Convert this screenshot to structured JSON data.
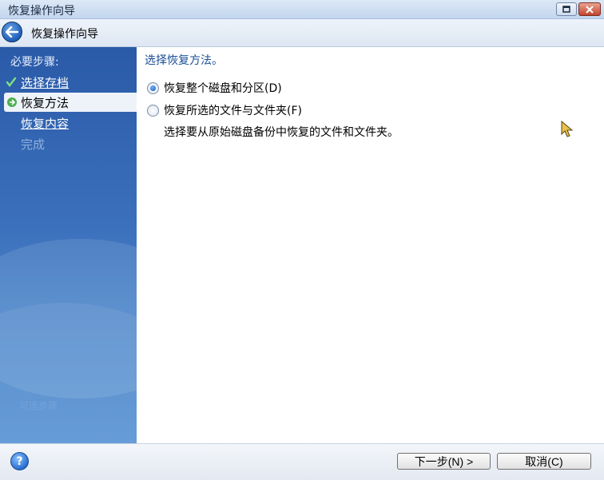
{
  "window": {
    "title": "恢复操作向导",
    "controls": [
      "restore-icon",
      "close-icon"
    ]
  },
  "header": {
    "title": "恢复操作向导",
    "back_icon": "back-arrow-icon"
  },
  "sidebar": {
    "heading": "必要步骤:",
    "steps": [
      {
        "label": "选择存档",
        "state": "done",
        "icon": "checkmark-icon"
      },
      {
        "label": "恢复方法",
        "state": "current",
        "icon": "arrow-right-icon"
      },
      {
        "label": "恢复内容",
        "state": "link"
      },
      {
        "label": "完成",
        "state": "disabled"
      }
    ],
    "footer_faded": "可选步骤"
  },
  "main": {
    "section_title": "选择恢复方法。",
    "options": [
      {
        "label": "恢复整个磁盘和分区(D)",
        "checked": true
      },
      {
        "label": "恢复所选的文件与文件夹(F)",
        "checked": false
      }
    ],
    "description": "选择要从原始磁盘备份中恢复的文件和文件夹。"
  },
  "footer": {
    "help_icon": "help-icon",
    "next_label": "下一步(N) >",
    "cancel_label": "取消(C)"
  },
  "colors": {
    "sidebar_top": "#2a5aa8",
    "sidebar_bottom": "#5b95d4",
    "section_title": "#1a4e96"
  }
}
